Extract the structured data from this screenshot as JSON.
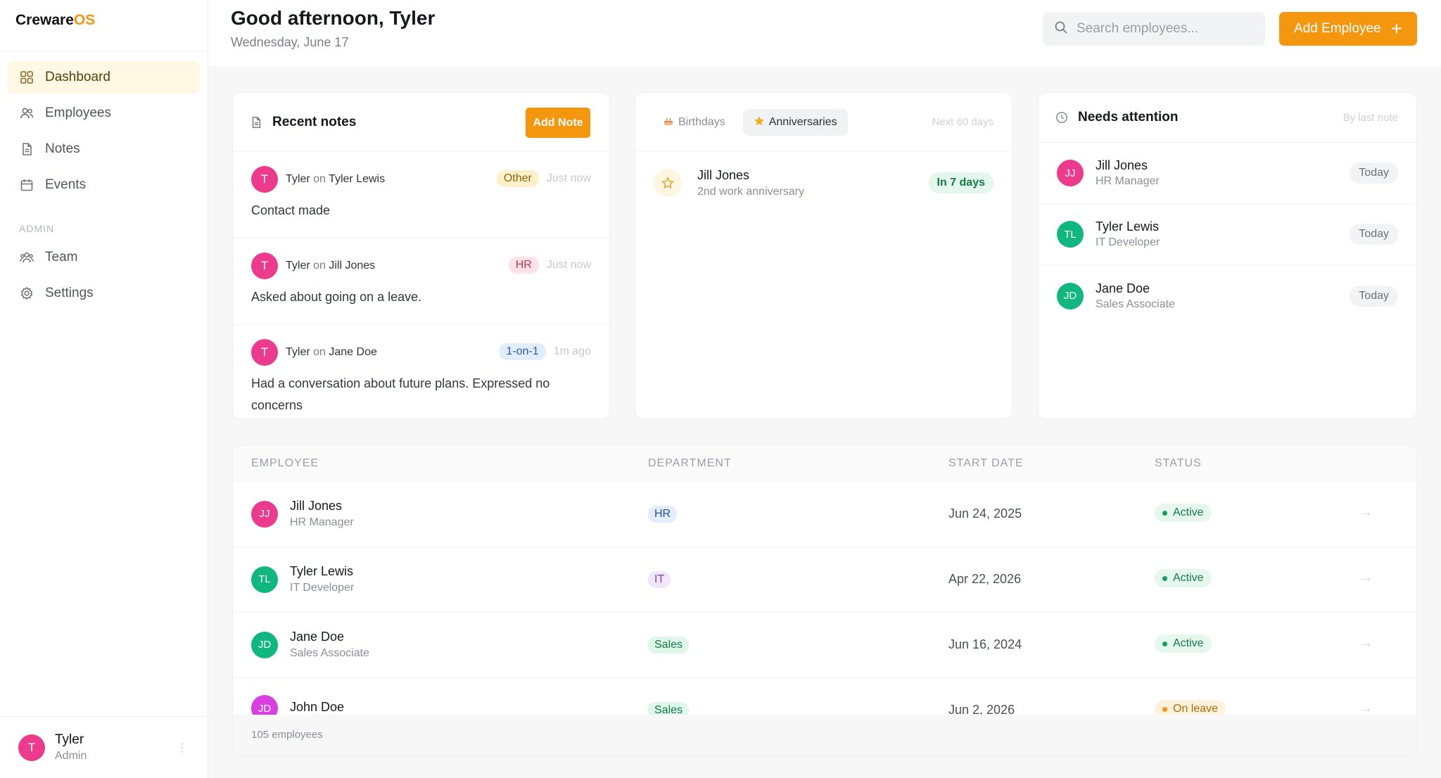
{
  "brand": {
    "name_main": "Creware",
    "name_accent": "OS"
  },
  "sidebar": {
    "items": [
      {
        "label": "Dashboard",
        "icon": "dashboard-icon",
        "active": true
      },
      {
        "label": "Employees",
        "icon": "users-icon"
      },
      {
        "label": "Notes",
        "icon": "document-icon"
      },
      {
        "label": "Events",
        "icon": "calendar-icon"
      }
    ],
    "admin_section": "ADMIN",
    "admin_items": [
      {
        "label": "Team",
        "icon": "team-icon"
      },
      {
        "label": "Settings",
        "icon": "gear-icon"
      }
    ],
    "user": {
      "initial": "T",
      "name": "Tyler",
      "role": "Admin"
    }
  },
  "header": {
    "greeting": "Good afternoon, Tyler",
    "date": "Wednesday, June 17",
    "search_placeholder": "Search employees...",
    "add_employee": "Add Employee",
    "add_icon": "+"
  },
  "notes_card": {
    "title": "Recent notes",
    "add_label": "Add Note",
    "notes": [
      {
        "initial": "T",
        "author": "Tyler",
        "on": "on",
        "subject": "Tyler Lewis",
        "tag": "Other",
        "time": "Just now",
        "text": "Contact made"
      },
      {
        "initial": "T",
        "author": "Tyler",
        "on": "on",
        "subject": "Jill Jones",
        "tag": "HR",
        "time": "Just now",
        "text": "Asked about going on a leave."
      },
      {
        "initial": "T",
        "author": "Tyler",
        "on": "on",
        "subject": "Jane Doe",
        "tag": "1-on-1",
        "time": "1m ago",
        "text": "Had a conversation about future plans. Expressed no concerns"
      }
    ]
  },
  "events_card": {
    "tabs": [
      "Birthdays",
      "Anniversaries"
    ],
    "active_tab": "Anniversaries",
    "range": "Next 60 days",
    "events": [
      {
        "name": "Jill Jones",
        "subtitle": "2nd work anniversary",
        "badge": "In 7 days"
      }
    ]
  },
  "attention_card": {
    "title": "Needs attention",
    "sort_label": "By last note",
    "people": [
      {
        "initials": "JJ",
        "name": "Jill Jones",
        "role": "HR Manager",
        "when": "Today",
        "color": "#ec3a8c"
      },
      {
        "initials": "TL",
        "name": "Tyler Lewis",
        "role": "IT Developer",
        "when": "Today",
        "color": "#10b77f"
      },
      {
        "initials": "JD",
        "name": "Jane Doe",
        "role": "Sales Associate",
        "when": "Today",
        "color": "#10b77f"
      }
    ]
  },
  "table": {
    "headers": [
      "EMPLOYEE",
      "DEPARTMENT",
      "START DATE",
      "STATUS"
    ],
    "rows": [
      {
        "initials": "JJ",
        "name": "Jill Jones",
        "role": "HR Manager",
        "dept": "HR",
        "start": "Jun 24, 2025",
        "status": "Active"
      },
      {
        "initials": "TL",
        "name": "Tyler Lewis",
        "role": "IT Developer",
        "dept": "IT",
        "start": "Apr 22, 2026",
        "status": "Active"
      },
      {
        "initials": "JD",
        "name": "Jane Doe",
        "role": "Sales Associate",
        "dept": "Sales",
        "start": "Jun 16, 2024",
        "status": "Active"
      },
      {
        "initials": "JD",
        "name": "John Doe",
        "role": "",
        "dept": "Sales",
        "start": "Jun 2, 2026",
        "status": "On leave"
      }
    ],
    "arrow": "→",
    "footer": "105 employees"
  },
  "colors": {
    "accent": "#f5960f",
    "pink": "#ec3a8c",
    "green": "#10b77f",
    "magenta": "#d83fe0"
  }
}
